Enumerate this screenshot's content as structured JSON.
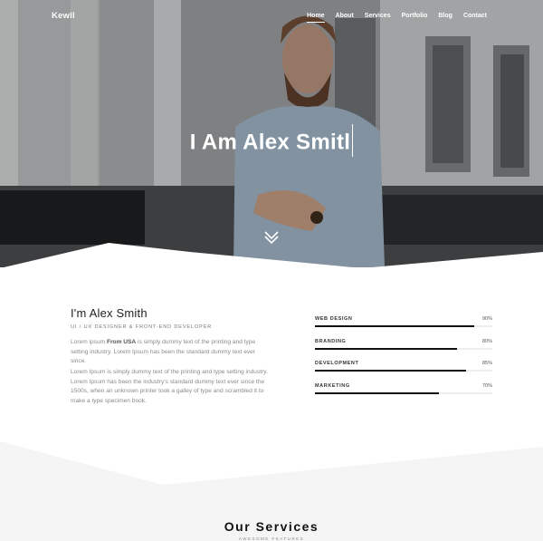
{
  "brand": {
    "logo": "Kewll"
  },
  "nav": {
    "items": [
      {
        "label": "Home",
        "active": true
      },
      {
        "label": "About",
        "active": false
      },
      {
        "label": "Services",
        "active": false
      },
      {
        "label": "Portfolio",
        "active": false
      },
      {
        "label": "Blog",
        "active": false
      },
      {
        "label": "Contact",
        "active": false
      }
    ]
  },
  "hero": {
    "typed_text": "I Am Alex Smitl",
    "scroll_icon": "double-chevron-down-icon"
  },
  "about": {
    "name": "I'm Alex Smith",
    "role": "UI / UX DESIGNER & FRONT-END DEVELOPER",
    "p1_before": "Lorem ipsum ",
    "p1_bold": "From USA",
    "p1_after": " is simply dummy text of the printing and type setting industry. Lorem Ipsum has been the standard dummy text ever since.",
    "p2": "Lorem Ipsum is simply dummy text of the printing and type setting industry. Lorem Ipsum has been the industry's standard dummy text ever since the 1500s, when an unknown printer took a galley of type and scrambled it to make a type specimen book."
  },
  "skills": [
    {
      "label": "WEB DESIGN",
      "percent": 90,
      "display": "90%"
    },
    {
      "label": "BRANDING",
      "percent": 80,
      "display": "80%"
    },
    {
      "label": "DEVELOPMENT",
      "percent": 85,
      "display": "85%"
    },
    {
      "label": "MARKETING",
      "percent": 70,
      "display": "70%"
    }
  ],
  "services": {
    "title": "Our Services",
    "subtitle": "AWESOME FEATURES"
  },
  "colors": {
    "accent": "#111111",
    "text": "#222222",
    "muted": "#8a8a8a",
    "section_bg": "#f5f5f5"
  }
}
